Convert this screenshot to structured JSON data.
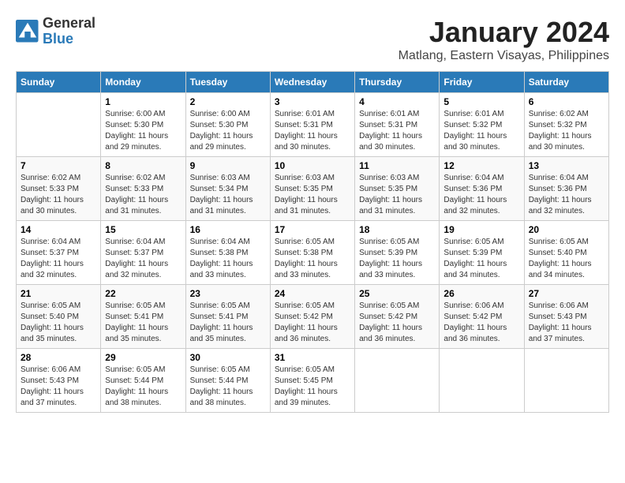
{
  "logo": {
    "line1": "General",
    "line2": "Blue"
  },
  "title": {
    "month_year": "January 2024",
    "location": "Matlang, Eastern Visayas, Philippines"
  },
  "calendar": {
    "headers": [
      "Sunday",
      "Monday",
      "Tuesday",
      "Wednesday",
      "Thursday",
      "Friday",
      "Saturday"
    ],
    "weeks": [
      [
        {
          "day": "",
          "info": ""
        },
        {
          "day": "1",
          "info": "Sunrise: 6:00 AM\nSunset: 5:30 PM\nDaylight: 11 hours\nand 29 minutes."
        },
        {
          "day": "2",
          "info": "Sunrise: 6:00 AM\nSunset: 5:30 PM\nDaylight: 11 hours\nand 29 minutes."
        },
        {
          "day": "3",
          "info": "Sunrise: 6:01 AM\nSunset: 5:31 PM\nDaylight: 11 hours\nand 30 minutes."
        },
        {
          "day": "4",
          "info": "Sunrise: 6:01 AM\nSunset: 5:31 PM\nDaylight: 11 hours\nand 30 minutes."
        },
        {
          "day": "5",
          "info": "Sunrise: 6:01 AM\nSunset: 5:32 PM\nDaylight: 11 hours\nand 30 minutes."
        },
        {
          "day": "6",
          "info": "Sunrise: 6:02 AM\nSunset: 5:32 PM\nDaylight: 11 hours\nand 30 minutes."
        }
      ],
      [
        {
          "day": "7",
          "info": "Sunrise: 6:02 AM\nSunset: 5:33 PM\nDaylight: 11 hours\nand 30 minutes."
        },
        {
          "day": "8",
          "info": "Sunrise: 6:02 AM\nSunset: 5:33 PM\nDaylight: 11 hours\nand 31 minutes."
        },
        {
          "day": "9",
          "info": "Sunrise: 6:03 AM\nSunset: 5:34 PM\nDaylight: 11 hours\nand 31 minutes."
        },
        {
          "day": "10",
          "info": "Sunrise: 6:03 AM\nSunset: 5:35 PM\nDaylight: 11 hours\nand 31 minutes."
        },
        {
          "day": "11",
          "info": "Sunrise: 6:03 AM\nSunset: 5:35 PM\nDaylight: 11 hours\nand 31 minutes."
        },
        {
          "day": "12",
          "info": "Sunrise: 6:04 AM\nSunset: 5:36 PM\nDaylight: 11 hours\nand 32 minutes."
        },
        {
          "day": "13",
          "info": "Sunrise: 6:04 AM\nSunset: 5:36 PM\nDaylight: 11 hours\nand 32 minutes."
        }
      ],
      [
        {
          "day": "14",
          "info": "Sunrise: 6:04 AM\nSunset: 5:37 PM\nDaylight: 11 hours\nand 32 minutes."
        },
        {
          "day": "15",
          "info": "Sunrise: 6:04 AM\nSunset: 5:37 PM\nDaylight: 11 hours\nand 32 minutes."
        },
        {
          "day": "16",
          "info": "Sunrise: 6:04 AM\nSunset: 5:38 PM\nDaylight: 11 hours\nand 33 minutes."
        },
        {
          "day": "17",
          "info": "Sunrise: 6:05 AM\nSunset: 5:38 PM\nDaylight: 11 hours\nand 33 minutes."
        },
        {
          "day": "18",
          "info": "Sunrise: 6:05 AM\nSunset: 5:39 PM\nDaylight: 11 hours\nand 33 minutes."
        },
        {
          "day": "19",
          "info": "Sunrise: 6:05 AM\nSunset: 5:39 PM\nDaylight: 11 hours\nand 34 minutes."
        },
        {
          "day": "20",
          "info": "Sunrise: 6:05 AM\nSunset: 5:40 PM\nDaylight: 11 hours\nand 34 minutes."
        }
      ],
      [
        {
          "day": "21",
          "info": "Sunrise: 6:05 AM\nSunset: 5:40 PM\nDaylight: 11 hours\nand 35 minutes."
        },
        {
          "day": "22",
          "info": "Sunrise: 6:05 AM\nSunset: 5:41 PM\nDaylight: 11 hours\nand 35 minutes."
        },
        {
          "day": "23",
          "info": "Sunrise: 6:05 AM\nSunset: 5:41 PM\nDaylight: 11 hours\nand 35 minutes."
        },
        {
          "day": "24",
          "info": "Sunrise: 6:05 AM\nSunset: 5:42 PM\nDaylight: 11 hours\nand 36 minutes."
        },
        {
          "day": "25",
          "info": "Sunrise: 6:05 AM\nSunset: 5:42 PM\nDaylight: 11 hours\nand 36 minutes."
        },
        {
          "day": "26",
          "info": "Sunrise: 6:06 AM\nSunset: 5:42 PM\nDaylight: 11 hours\nand 36 minutes."
        },
        {
          "day": "27",
          "info": "Sunrise: 6:06 AM\nSunset: 5:43 PM\nDaylight: 11 hours\nand 37 minutes."
        }
      ],
      [
        {
          "day": "28",
          "info": "Sunrise: 6:06 AM\nSunset: 5:43 PM\nDaylight: 11 hours\nand 37 minutes."
        },
        {
          "day": "29",
          "info": "Sunrise: 6:05 AM\nSunset: 5:44 PM\nDaylight: 11 hours\nand 38 minutes."
        },
        {
          "day": "30",
          "info": "Sunrise: 6:05 AM\nSunset: 5:44 PM\nDaylight: 11 hours\nand 38 minutes."
        },
        {
          "day": "31",
          "info": "Sunrise: 6:05 AM\nSunset: 5:45 PM\nDaylight: 11 hours\nand 39 minutes."
        },
        {
          "day": "",
          "info": ""
        },
        {
          "day": "",
          "info": ""
        },
        {
          "day": "",
          "info": ""
        }
      ]
    ]
  }
}
